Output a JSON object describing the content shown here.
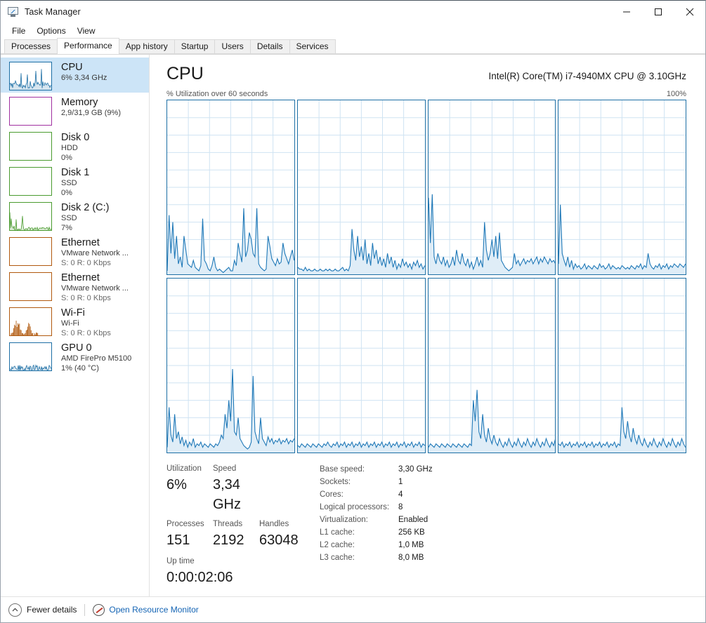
{
  "window": {
    "title": "Task Manager",
    "icon": "task-manager-icon",
    "minimize": "─",
    "maximize": "□",
    "close": "×"
  },
  "menu": {
    "items": [
      "File",
      "Options",
      "View"
    ]
  },
  "tabs": {
    "items": [
      "Processes",
      "Performance",
      "App history",
      "Startup",
      "Users",
      "Details",
      "Services"
    ],
    "active": "Performance"
  },
  "sidebar": {
    "items": [
      {
        "title": "CPU",
        "sub1": "6%  3,34 GHz",
        "sub2": "",
        "color": "#1d6fa5",
        "selected": true,
        "graph": "cpu"
      },
      {
        "title": "Memory",
        "sub1": "2,9/31,9 GB (9%)",
        "sub2": "",
        "color": "#a030a0",
        "selected": false,
        "graph": "empty"
      },
      {
        "title": "Disk 0",
        "sub1": "HDD",
        "sub2": "0%",
        "color": "#4a9b2f",
        "selected": false,
        "graph": "empty"
      },
      {
        "title": "Disk 1",
        "sub1": "SSD",
        "sub2": "0%",
        "color": "#4a9b2f",
        "selected": false,
        "graph": "empty"
      },
      {
        "title": "Disk 2 (C:)",
        "sub1": "SSD",
        "sub2": "7%",
        "color": "#4a9b2f",
        "selected": false,
        "graph": "disk"
      },
      {
        "title": "Ethernet",
        "sub1": "VMware Network ...",
        "sub2": "S: 0 R: 0 Kbps",
        "color": "#b1590e",
        "selected": false,
        "graph": "empty"
      },
      {
        "title": "Ethernet",
        "sub1": "VMware Network ...",
        "sub2": "S: 0 R: 0 Kbps",
        "color": "#b1590e",
        "selected": false,
        "graph": "empty"
      },
      {
        "title": "Wi-Fi",
        "sub1": "Wi-Fi",
        "sub2": "S: 0 R: 0 Kbps",
        "color": "#b1590e",
        "selected": false,
        "graph": "wifi"
      },
      {
        "title": "GPU 0",
        "sub1": "AMD FirePro M5100",
        "sub2": "1%  (40 °C)",
        "color": "#1d6fa5",
        "selected": false,
        "graph": "gpu"
      }
    ]
  },
  "main": {
    "heading": "CPU",
    "model": "Intel(R) Core(TM) i7-4940MX CPU @ 3.10GHz",
    "graph_caption": "% Utilization over 60 seconds",
    "graph_max": "100%"
  },
  "stats": {
    "utilization_label": "Utilization",
    "utilization_value": "6%",
    "speed_label": "Speed",
    "speed_value": "3,34 GHz",
    "processes_label": "Processes",
    "processes_value": "151",
    "threads_label": "Threads",
    "threads_value": "2192",
    "handles_label": "Handles",
    "handles_value": "63048",
    "uptime_label": "Up time",
    "uptime_value": "0:00:02:06",
    "details": [
      {
        "key": "Base speed:",
        "value": "3,30 GHz"
      },
      {
        "key": "Sockets:",
        "value": "1"
      },
      {
        "key": "Cores:",
        "value": "4"
      },
      {
        "key": "Logical processors:",
        "value": "8"
      },
      {
        "key": "Virtualization:",
        "value": "Enabled"
      },
      {
        "key": "L1 cache:",
        "value": "256 KB"
      },
      {
        "key": "L2 cache:",
        "value": "1,0 MB"
      },
      {
        "key": "L3 cache:",
        "value": "8,0 MB"
      }
    ]
  },
  "footer": {
    "fewer_details": "Fewer details",
    "resource_monitor": "Open Resource Monitor",
    "chevron": "chevron-up-icon",
    "rm_icon": "resource-monitor-icon"
  },
  "chart_data": {
    "type": "line",
    "title": "% Utilization over 60 seconds",
    "ylabel": "% Utilization",
    "xlabel": "60 seconds",
    "ylim": [
      0,
      100
    ],
    "grid": true,
    "legend": false,
    "line_color": "#2079b8",
    "fill_color": "#dfedf7",
    "note": "Eight logical-processor graphs, each 0-100% over 60 seconds",
    "series": [
      {
        "name": "CPU 0",
        "values": [
          2,
          34,
          12,
          30,
          9,
          22,
          6,
          10,
          4,
          22,
          14,
          6,
          5,
          4,
          8,
          4,
          3,
          2,
          5,
          32,
          8,
          6,
          3,
          2,
          5,
          10,
          4,
          2,
          3,
          2,
          1,
          2,
          3,
          4,
          2,
          2,
          8,
          5,
          18,
          12,
          7,
          38,
          10,
          14,
          24,
          20,
          12,
          10,
          38,
          6,
          4,
          3,
          2,
          3,
          22,
          16,
          9,
          7,
          5,
          9,
          6,
          7,
          18,
          12,
          9,
          6,
          10,
          14,
          8
        ]
      },
      {
        "name": "CPU 1",
        "values": [
          4,
          3,
          3,
          2,
          4,
          2,
          3,
          2,
          2,
          3,
          2,
          2,
          3,
          2,
          2,
          3,
          2,
          3,
          2,
          2,
          3,
          2,
          2,
          3,
          4,
          2,
          3,
          2,
          5,
          26,
          14,
          8,
          22,
          10,
          16,
          8,
          20,
          6,
          12,
          5,
          18,
          9,
          14,
          6,
          10,
          5,
          9,
          4,
          12,
          6,
          10,
          4,
          8,
          3,
          6,
          4,
          9,
          5,
          7,
          4,
          6,
          3,
          7,
          5,
          8,
          4,
          6,
          3,
          5
        ]
      },
      {
        "name": "CPU 2",
        "values": [
          44,
          18,
          46,
          10,
          6,
          12,
          8,
          6,
          10,
          5,
          8,
          4,
          6,
          10,
          5,
          14,
          8,
          6,
          12,
          7,
          5,
          9,
          4,
          7,
          3,
          6,
          10,
          5,
          8,
          4,
          30,
          14,
          8,
          12,
          20,
          10,
          22,
          9,
          24,
          8,
          6,
          4,
          3,
          2,
          3,
          4,
          12,
          6,
          8,
          5,
          7,
          9,
          6,
          8,
          7,
          9,
          6,
          8,
          10,
          6,
          9,
          7,
          10,
          8,
          6,
          9,
          7,
          8,
          6
        ]
      },
      {
        "name": "CPU 3",
        "values": [
          6,
          40,
          12,
          8,
          5,
          10,
          4,
          8,
          3,
          6,
          4,
          5,
          3,
          4,
          6,
          3,
          5,
          4,
          3,
          5,
          4,
          3,
          6,
          4,
          5,
          3,
          4,
          6,
          3,
          5,
          4,
          3,
          4,
          3,
          5,
          4,
          3,
          4,
          3,
          5,
          4,
          3,
          5,
          4,
          6,
          3,
          5,
          4,
          12,
          6,
          4,
          3,
          5,
          4,
          6,
          3,
          5,
          4,
          6,
          3,
          5,
          4,
          6,
          5,
          4,
          6,
          5,
          4,
          6
        ]
      },
      {
        "name": "CPU 4",
        "values": [
          3,
          26,
          10,
          6,
          22,
          8,
          12,
          5,
          9,
          4,
          7,
          3,
          6,
          4,
          8,
          3,
          5,
          4,
          6,
          3,
          5,
          4,
          3,
          5,
          4,
          3,
          5,
          4,
          6,
          10,
          8,
          22,
          14,
          30,
          18,
          48,
          12,
          10,
          20,
          8,
          6,
          4,
          3,
          2,
          3,
          6,
          44,
          12,
          8,
          5,
          20,
          8,
          6,
          4,
          9,
          6,
          8,
          5,
          7,
          6,
          8,
          5,
          7,
          6,
          8,
          5,
          7,
          6,
          8
        ]
      },
      {
        "name": "CPU 5",
        "values": [
          4,
          3,
          5,
          4,
          3,
          5,
          4,
          3,
          5,
          4,
          3,
          5,
          4,
          3,
          5,
          4,
          6,
          4,
          3,
          5,
          4,
          6,
          3,
          5,
          4,
          6,
          3,
          5,
          4,
          6,
          3,
          5,
          4,
          6,
          3,
          5,
          4,
          6,
          3,
          5,
          4,
          6,
          3,
          5,
          4,
          6,
          3,
          5,
          4,
          6,
          3,
          5,
          4,
          6,
          3,
          5,
          4,
          6,
          3,
          5,
          4,
          6,
          3,
          5,
          4,
          6,
          3,
          5,
          4
        ]
      },
      {
        "name": "CPU 6",
        "values": [
          3,
          5,
          4,
          3,
          5,
          4,
          3,
          5,
          4,
          3,
          5,
          4,
          3,
          5,
          4,
          3,
          5,
          4,
          3,
          5,
          4,
          3,
          5,
          4,
          30,
          18,
          36,
          12,
          8,
          22,
          10,
          6,
          14,
          8,
          5,
          10,
          6,
          4,
          8,
          5,
          3,
          6,
          4,
          8,
          5,
          3,
          6,
          4,
          8,
          5,
          3,
          6,
          4,
          8,
          5,
          3,
          6,
          4,
          8,
          5,
          3,
          6,
          4,
          8,
          5,
          3,
          6,
          4,
          8
        ]
      },
      {
        "name": "CPU 7",
        "values": [
          5,
          4,
          6,
          3,
          5,
          4,
          6,
          3,
          5,
          4,
          6,
          3,
          5,
          4,
          6,
          3,
          5,
          4,
          6,
          3,
          5,
          4,
          6,
          3,
          5,
          4,
          6,
          3,
          5,
          4,
          6,
          3,
          5,
          4,
          26,
          12,
          8,
          18,
          10,
          6,
          14,
          8,
          5,
          10,
          6,
          4,
          8,
          5,
          3,
          6,
          4,
          8,
          5,
          3,
          6,
          4,
          8,
          5,
          3,
          6,
          4,
          8,
          5,
          3,
          6,
          4,
          8,
          5,
          3
        ]
      }
    ]
  }
}
